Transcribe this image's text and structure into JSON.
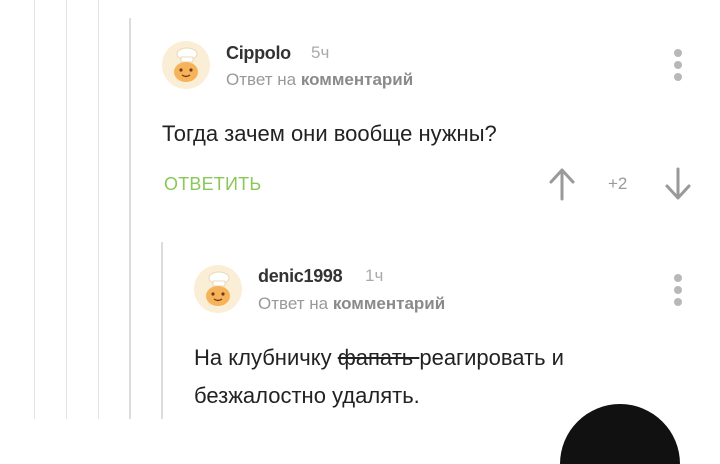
{
  "comments": [
    {
      "author": "Cippolo",
      "time": "5ч",
      "reply_prefix": "Ответ на",
      "reply_target": "комментарий",
      "text": "Тогда зачем они вообще нужны?",
      "reply_label": "ОТВЕТИТЬ",
      "rating": "+2"
    },
    {
      "author": "denic1998",
      "time": "1ч",
      "reply_prefix": "Ответ на",
      "reply_target": "комментарий",
      "text_before": "На клубничку ",
      "text_struck": "фапать ",
      "text_after": "реагировать и",
      "text_line2": "безжалостно удалять."
    }
  ],
  "colors": {
    "accent_green": "#8ac858",
    "avatar_bg": "#fbeed6",
    "muted": "#999999"
  }
}
